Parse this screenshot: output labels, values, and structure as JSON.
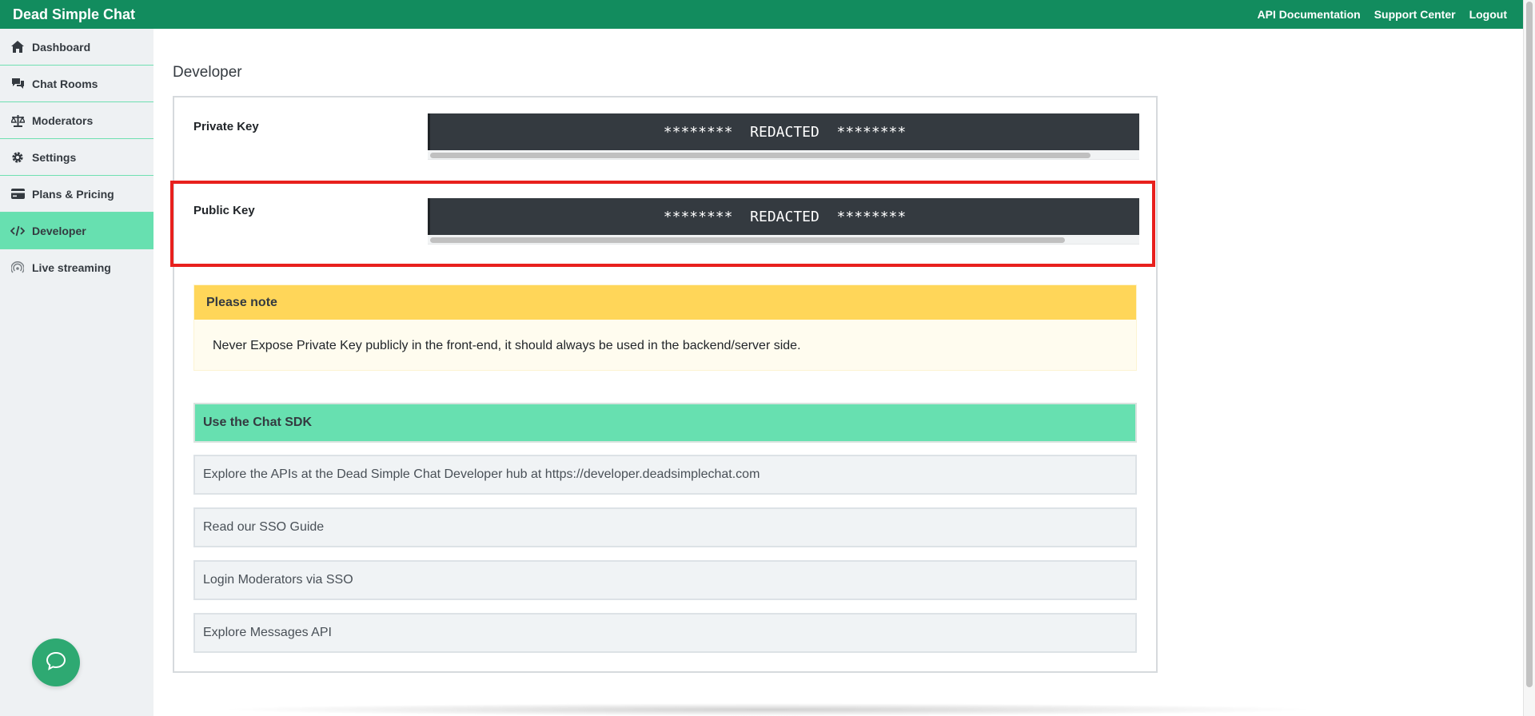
{
  "app": {
    "brand": "Dead Simple Chat"
  },
  "topnav": {
    "items": [
      {
        "label": "API Documentation"
      },
      {
        "label": "Support Center"
      },
      {
        "label": "Logout"
      }
    ]
  },
  "sidebar": {
    "items": [
      {
        "label": "Dashboard",
        "icon": "home-icon"
      },
      {
        "label": "Chat Rooms",
        "icon": "chat-icon"
      },
      {
        "label": "Moderators",
        "icon": "scale-icon"
      },
      {
        "label": "Settings",
        "icon": "gear-icon"
      },
      {
        "label": "Plans & Pricing",
        "icon": "credit-card-icon"
      },
      {
        "label": "Developer",
        "icon": "code-icon",
        "active": true
      },
      {
        "label": "Live streaming",
        "icon": "broadcast-icon"
      }
    ]
  },
  "main": {
    "title": "Developer",
    "private_key": {
      "label": "Private Key",
      "value": "********  REDACTED  ********"
    },
    "public_key": {
      "label": "Public Key",
      "value": "********  REDACTED  ********"
    },
    "note": {
      "heading": "Please note",
      "body": "Never Expose Private Key publicly in the front-end, it should always be used in the backend/server side."
    },
    "sdk": {
      "heading": "Use the Chat SDK",
      "items": [
        {
          "label": "Explore the APIs at the Dead Simple Chat Developer hub at https://developer.deadsimplechat.com"
        },
        {
          "label": "Read our SSO Guide"
        },
        {
          "label": "Login Moderators via SSO"
        },
        {
          "label": "Explore Messages API"
        }
      ]
    }
  },
  "colors": {
    "topbar": "#128c5e",
    "active_nav": "#67e0b0",
    "note_header": "#ffd659",
    "highlight": "#e8201d",
    "key_box": "#343a40"
  }
}
